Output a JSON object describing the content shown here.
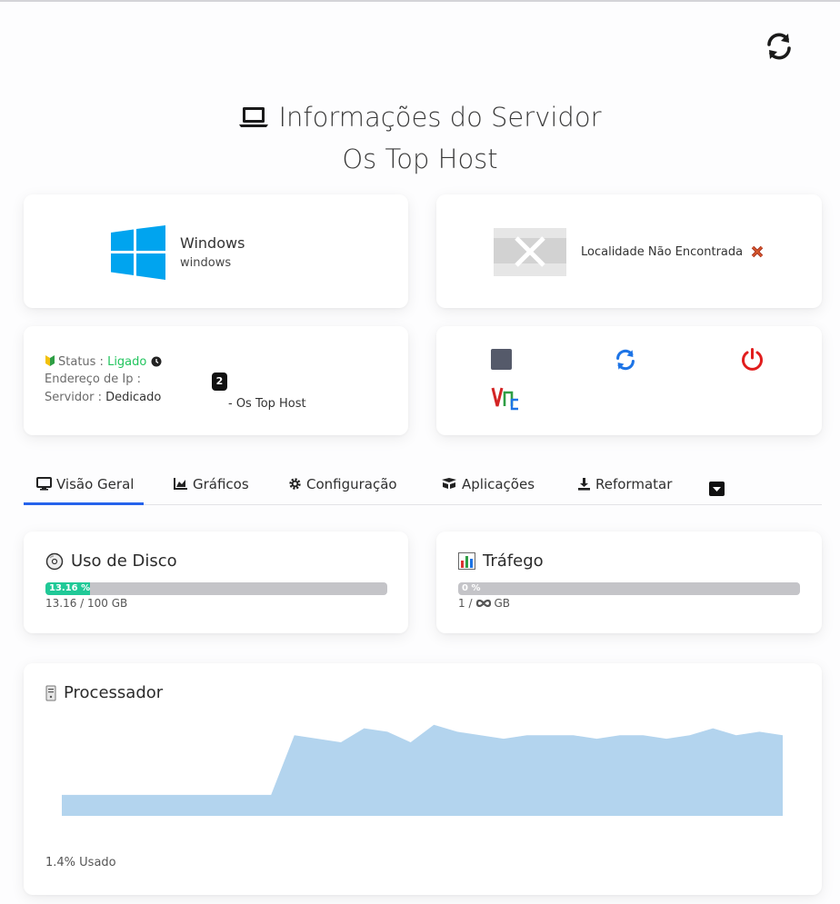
{
  "header": {
    "title": "Informações do Servidor",
    "server_name": "Os Top Host"
  },
  "os": {
    "name": "Windows",
    "sub": "windows"
  },
  "location": {
    "text": "Localidade Não Encontrada"
  },
  "status": {
    "status_label": "Status :",
    "status_value": "Ligado",
    "ip_label": "Endereço de Ip :",
    "server_label": "Servidor :",
    "server_value": "Dedicado",
    "badge": "2",
    "host_tag": "- Os Top Host"
  },
  "actions": [
    "stop-icon",
    "restart-icon",
    "power-icon",
    "vnc-icon"
  ],
  "tabs": [
    {
      "label": "Visão Geral",
      "icon": "monitor-icon",
      "active": true
    },
    {
      "label": "Gráficos",
      "icon": "area-chart-icon",
      "active": false
    },
    {
      "label": "Configuração",
      "icon": "gear-icon",
      "active": false
    },
    {
      "label": "Aplicações",
      "icon": "boxes-icon",
      "active": false
    },
    {
      "label": "Reformatar",
      "icon": "download-icon",
      "active": false
    }
  ],
  "disk": {
    "title": "Uso de Disco",
    "percent_label": "13.16 %",
    "percent": 13.16,
    "usage_text": "13.16 / 100 GB"
  },
  "traffic": {
    "title": "Tráfego",
    "percent_label": "0 %",
    "percent": 0,
    "usage_prefix": "1 /",
    "usage_suffix": "GB"
  },
  "processor": {
    "title": "Processador",
    "used_text": "1.4% Usado"
  },
  "chart_data": {
    "type": "area",
    "title": "Processador",
    "values": [
      0.6,
      0.6,
      0.6,
      0.6,
      0.6,
      0.6,
      0.6,
      0.6,
      0.6,
      0.6,
      2.3,
      2.2,
      2.1,
      2.5,
      2.4,
      2.1,
      2.6,
      2.4,
      2.3,
      2.2,
      2.3,
      2.3,
      2.3,
      2.2,
      2.3,
      2.3,
      2.2,
      2.3,
      2.5,
      2.3,
      2.4,
      2.3
    ],
    "ylim": [
      0,
      2.8
    ],
    "color": "#b3d4ee"
  },
  "colors": {
    "accent": "#2563eb",
    "status_green": "#22c55e",
    "bar_fill": "#20c997",
    "bar_bg": "#c4c4c8",
    "power_red": "#e11d1d",
    "restart_blue": "#1d74e6"
  }
}
